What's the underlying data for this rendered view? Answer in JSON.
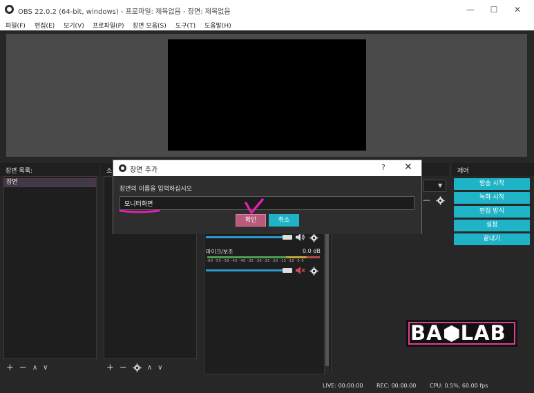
{
  "window": {
    "title": "OBS 22.0.2 (64-bit, windows) - 프로파일: 제목없음 - 장면: 제목없음",
    "minimize_glyph": "—",
    "maximize_glyph": "☐",
    "close_glyph": "✕"
  },
  "menu": [
    "파일(F)",
    "편집(E)",
    "보기(V)",
    "프로파일(P)",
    "장면 모음(S)",
    "도구(T)",
    "도움말(H)"
  ],
  "docks": {
    "scenes_title": "장면 목록:",
    "sources_title": "소",
    "controls_title": "제어"
  },
  "scenes": {
    "items": [
      "장면"
    ],
    "toolbar": {
      "add": "+",
      "remove": "−",
      "up": "∧",
      "down": "∨"
    }
  },
  "sources": {
    "toolbar": {
      "add": "+",
      "remove": "−",
      "up": "∧",
      "down": "∨"
    }
  },
  "mixer": {
    "dropdown_arrow": "▼",
    "channels": [
      {
        "name": "",
        "level": "",
        "volume": 0.93,
        "muted": false
      },
      {
        "name": "마이크/보조",
        "level": "0.0 dB",
        "volume": 0.93,
        "muted": true
      }
    ],
    "ticks": "-60 -55 -50 -45 -40 -35 -30 -25 -20 -15 -10 -5 0"
  },
  "controls": [
    "방송 시작",
    "녹화 시작",
    "편집 방식",
    "설정",
    "끝내기"
  ],
  "status": {
    "live": "LIVE: 00:00:00",
    "rec": "REC: 00:00:00",
    "cpu": "CPU: 0.5%, 60.00 fps"
  },
  "logo": {
    "left": "BA",
    "right": "LAB"
  },
  "dialog": {
    "title": "장면 추가",
    "help": "?",
    "close": "✕",
    "prompt": "장면의 이름을 입력하십시오",
    "input_value": "모니터화면",
    "ok_label": "확인",
    "cancel_label": "취소"
  },
  "colors": {
    "accent": "#1fb3c8",
    "ok_button": "#b85a7a",
    "annotation": "#e020b0"
  }
}
